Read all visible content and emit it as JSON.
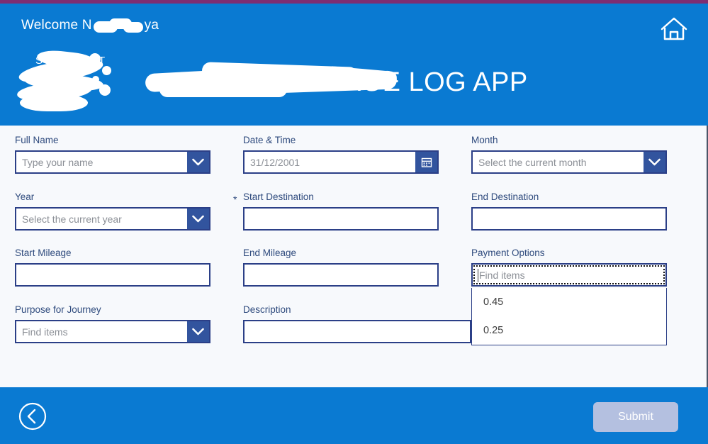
{
  "theme": {
    "accent_strip": "#7e2d72",
    "header_blue": "#0a7ad2",
    "field_border": "#2b3f87",
    "ctl_button_blue": "#32549e",
    "label_color": "#2e4a7d",
    "submit_disabled": "#b4c0e0",
    "page_background": "#f7f9fc"
  },
  "header": {
    "welcome_prefix": "Welcome N",
    "welcome_suffix": "ya",
    "app_title": "MILEAGE LOG APP",
    "logo_text": "SYSTEMS IT",
    "home_icon": "home-icon"
  },
  "form": {
    "full_name": {
      "label": "Full Name",
      "placeholder": "Type your name",
      "icon": "chevron-down-icon",
      "required": false
    },
    "date_time": {
      "label": "Date & Time",
      "placeholder": "31/12/2001",
      "icon": "calendar-icon",
      "required": false
    },
    "month": {
      "label": "Month",
      "placeholder": "Select the current month",
      "icon": "chevron-down-icon",
      "required": false
    },
    "year": {
      "label": "Year",
      "placeholder": "Select the current year",
      "icon": "chevron-down-icon",
      "required": false
    },
    "start_destination": {
      "label": "Start Destination",
      "value": "",
      "required": true,
      "required_marker": "*"
    },
    "end_destination": {
      "label": "End Destination",
      "value": "",
      "required": false
    },
    "start_mileage": {
      "label": "Start Mileage",
      "value": "",
      "required": false
    },
    "end_mileage": {
      "label": "End Mileage",
      "value": "",
      "required": false
    },
    "payment_options": {
      "label": "Payment Options",
      "placeholder": "Find items",
      "focused": true,
      "expanded": true,
      "options": [
        "0.45",
        "0.25"
      ]
    },
    "purpose_for_journey": {
      "label": "Purpose for Journey",
      "placeholder": "Find items",
      "icon": "chevron-down-icon",
      "required": false
    },
    "description": {
      "label": "Description",
      "value": "",
      "required": false
    }
  },
  "footer": {
    "back_icon": "chevron-left-circle-icon",
    "submit_label": "Submit",
    "submit_enabled": false
  }
}
